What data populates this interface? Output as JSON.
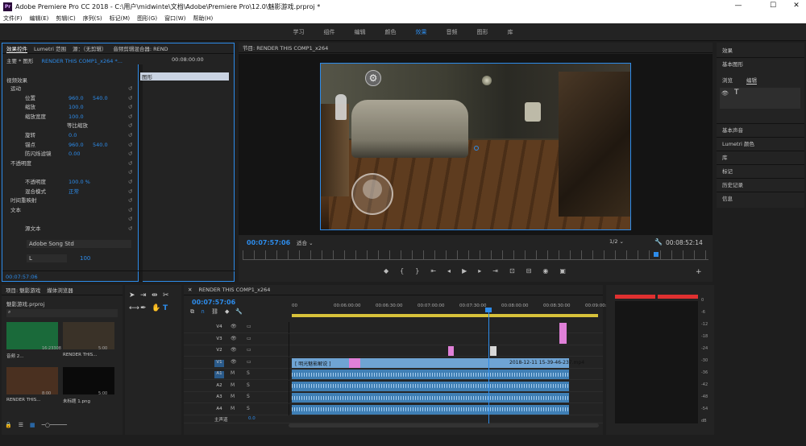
{
  "window": {
    "title": "Adobe Premiere Pro CC 2018 - C:\\用户\\midwinte\\文档\\Adobe\\Premiere Pro\\12.0\\魅影游戏.prproj *",
    "logo": "Pr",
    "min": "—",
    "max": "☐",
    "close": "✕"
  },
  "menu": [
    "文件(F)",
    "编辑(E)",
    "剪辑(C)",
    "序列(S)",
    "标记(M)",
    "图形(G)",
    "窗口(W)",
    "帮助(H)"
  ],
  "workspaces": [
    "学习",
    "组件",
    "编辑",
    "颜色",
    "效果",
    "音频",
    "图形",
    "库"
  ],
  "active_workspace": "效果",
  "effects_panel": {
    "tabs": [
      "效果控件",
      "Lumetri 范围",
      "源：（无剪辑）",
      "音频剪辑混合器: REND"
    ],
    "master": "主要 * 图形",
    "clip": "RENDER THIS COMP1_x264 *...",
    "timecode": "00:08:00:00",
    "clip_label": "图形",
    "section": "视频效果",
    "footer_time": "00:07:57:06",
    "rows": [
      {
        "indent": 10,
        "label": "运动",
        "v1": "",
        "v2": ""
      },
      {
        "indent": 28,
        "label": "位置",
        "v1": "960.0",
        "v2": "540.0"
      },
      {
        "indent": 28,
        "label": "缩放",
        "v1": "100.0",
        "v2": ""
      },
      {
        "indent": 28,
        "label": "缩放宽度",
        "v1": "100.0",
        "v2": ""
      },
      {
        "indent": 80,
        "label": "等比缩放",
        "v1": "",
        "v2": ""
      },
      {
        "indent": 28,
        "label": "旋转",
        "v1": "0.0",
        "v2": ""
      },
      {
        "indent": 28,
        "label": "锚点",
        "v1": "960.0",
        "v2": "540.0"
      },
      {
        "indent": 28,
        "label": "防闪烁滤镜",
        "v1": "0.00",
        "v2": ""
      },
      {
        "indent": 10,
        "label": "不透明度",
        "v1": "",
        "v2": ""
      },
      {
        "indent": 0,
        "label": "",
        "v1": "",
        "v2": ""
      },
      {
        "indent": 28,
        "label": "不透明度",
        "v1": "100.0 %",
        "v2": ""
      },
      {
        "indent": 28,
        "label": "混合模式",
        "v1": "正常",
        "v2": ""
      },
      {
        "indent": 10,
        "label": "时间重映射",
        "v1": "",
        "v2": ""
      },
      {
        "indent": 10,
        "label": "文本",
        "v1": "",
        "v2": ""
      },
      {
        "indent": 0,
        "label": "",
        "v1": "",
        "v2": ""
      },
      {
        "indent": 28,
        "label": "源文本",
        "v1": "",
        "v2": ""
      }
    ],
    "font": "Adobe Song Std",
    "font_style": "L",
    "font_size": "100"
  },
  "program": {
    "title": "节目: RENDER THIS COMP1_x264",
    "timecode": "00:07:57:06",
    "fit": "适合",
    "quality": "1/2",
    "duration": "00:08:52:14"
  },
  "right_panel": {
    "top": "效果",
    "basic_graphics": "基本图形",
    "tabs": [
      "浏览",
      "编辑"
    ],
    "items": [
      "基本声音",
      "Lumetri 颜色",
      "库",
      "标记",
      "历史记录",
      "信息"
    ]
  },
  "project": {
    "tabs": [
      "项目: 魅影游戏",
      "媒体浏览器"
    ],
    "file": "魅影游戏.prproj",
    "items": [
      {
        "name": "音频 2...",
        "meta": "16:23308",
        "color": "#1a6a3a"
      },
      {
        "name": "RENDER THIS...",
        "meta": "5:00",
        "color": "#3a3228"
      },
      {
        "name": "RENDER THIS...",
        "meta": "8:00",
        "color": "#4a3020"
      },
      {
        "name": "未标题 1.png",
        "meta": "5:00",
        "color": "#0a0a0a"
      }
    ]
  },
  "timeline": {
    "title": "RENDER THIS COMP1_x264",
    "timecode": "00:07:57:06",
    "ticks": [
      "00",
      "00:06:00:00",
      "00:06:30:00",
      "00:07:00:00",
      "00:07:30:00",
      "00:08:00:00",
      "00:08:30:00",
      "00:09:00:00"
    ],
    "tracks": [
      "V4",
      "V3",
      "V2",
      "V1",
      "A1",
      "A2",
      "A3",
      "A4"
    ],
    "clip_label": "[ 明光魅影解说 ]",
    "clip_file": "2018-12-11 15-39-46-237.mp4",
    "master": "主声道",
    "master_val": "0.0"
  },
  "meter": {
    "scale": [
      "0",
      "-6",
      "-12",
      "-18",
      "-24",
      "-30",
      "-36",
      "-42",
      "-48",
      "-54",
      "dB"
    ]
  }
}
